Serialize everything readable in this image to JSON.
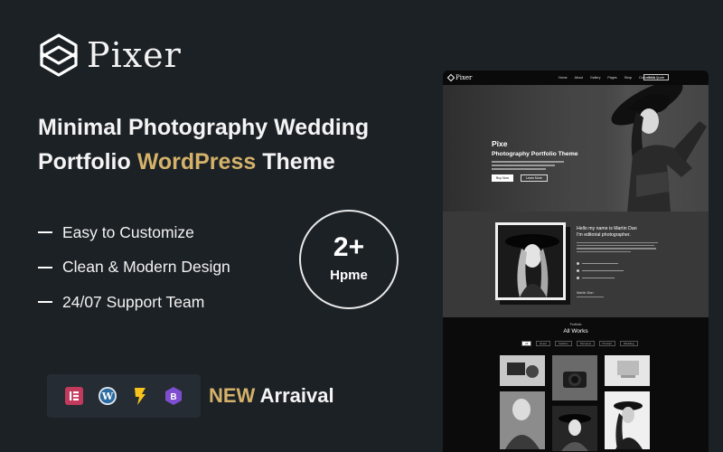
{
  "brand": {
    "name": "Pixer",
    "logo_icon": "pixer-logo-icon"
  },
  "headline": {
    "line1": "Minimal Photography Wedding",
    "line2_start": "Portfolio ",
    "line2_accent": "WordPress",
    "line2_end": " Theme"
  },
  "features": [
    "Easy to Customize",
    "Clean & Modern Design",
    "24/07 Support Team"
  ],
  "badge": {
    "number": "2+",
    "label": "Hpme"
  },
  "plugins": [
    "elementor-icon",
    "wordpress-icon",
    "lightning-icon",
    "bootstrap-icon"
  ],
  "arrival": {
    "accent": "NEW",
    "text": " Arraival"
  },
  "colors": {
    "background": "#1c2126",
    "accent": "#d5b26a",
    "panel": "#262c33"
  },
  "preview": {
    "brand": "Pixer",
    "menu": [
      "Home",
      "About",
      "Gallery",
      "Pages",
      "Shop",
      "Contact Us"
    ],
    "cta": "Get A Quote",
    "hero_title": "Pixe",
    "hero_subtitle": "Photography Portfolio Theme",
    "hero_btn1": "Buy Now",
    "hero_btn2": "Learn More",
    "about_line1": "Hello my name is Martin Dan",
    "about_line2": "I'm editorial photographer.",
    "about_sign": "Martin Dan",
    "works_small": "Portfolio",
    "works_title": "All Works",
    "work_tabs": [
      "All",
      "Event",
      "Fashion",
      "Personal",
      "Product",
      "Wedding"
    ]
  }
}
